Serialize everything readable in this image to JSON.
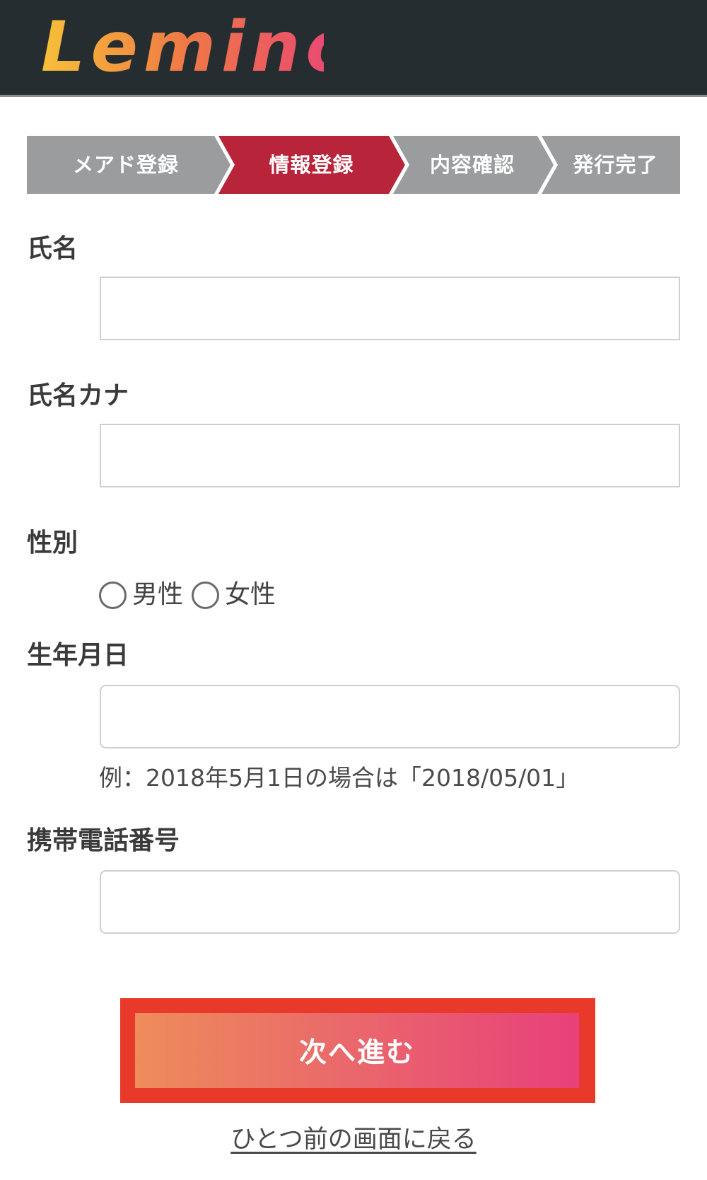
{
  "header": {
    "logo_text": "Lemino"
  },
  "steps": [
    {
      "label": "メアド登録",
      "state": "done"
    },
    {
      "label": "情報登録",
      "state": "active"
    },
    {
      "label": "内容確認",
      "state": "pending"
    },
    {
      "label": "発行完了",
      "state": "pending"
    }
  ],
  "form": {
    "name": {
      "label": "氏名",
      "value": ""
    },
    "name_kana": {
      "label": "氏名カナ",
      "value": ""
    },
    "gender": {
      "label": "性別",
      "options": [
        {
          "label": "男性",
          "selected": false
        },
        {
          "label": "女性",
          "selected": false
        }
      ]
    },
    "birthday": {
      "label": "生年月日",
      "value": "",
      "hint": "例：2018年5月1日の場合は「2018/05/01」"
    },
    "phone": {
      "label": "携帯電話番号",
      "value": ""
    }
  },
  "actions": {
    "next_label": "次へ進む",
    "back_label": "ひとつ前の画面に戻る"
  },
  "colors": {
    "header_bg": "#252d31",
    "step_inactive": "#9a9c9d",
    "step_active": "#b8253a",
    "cta_outline": "#e8392b",
    "cta_gradient_start": "#ee8c5a",
    "cta_gradient_end": "#e8407a"
  }
}
